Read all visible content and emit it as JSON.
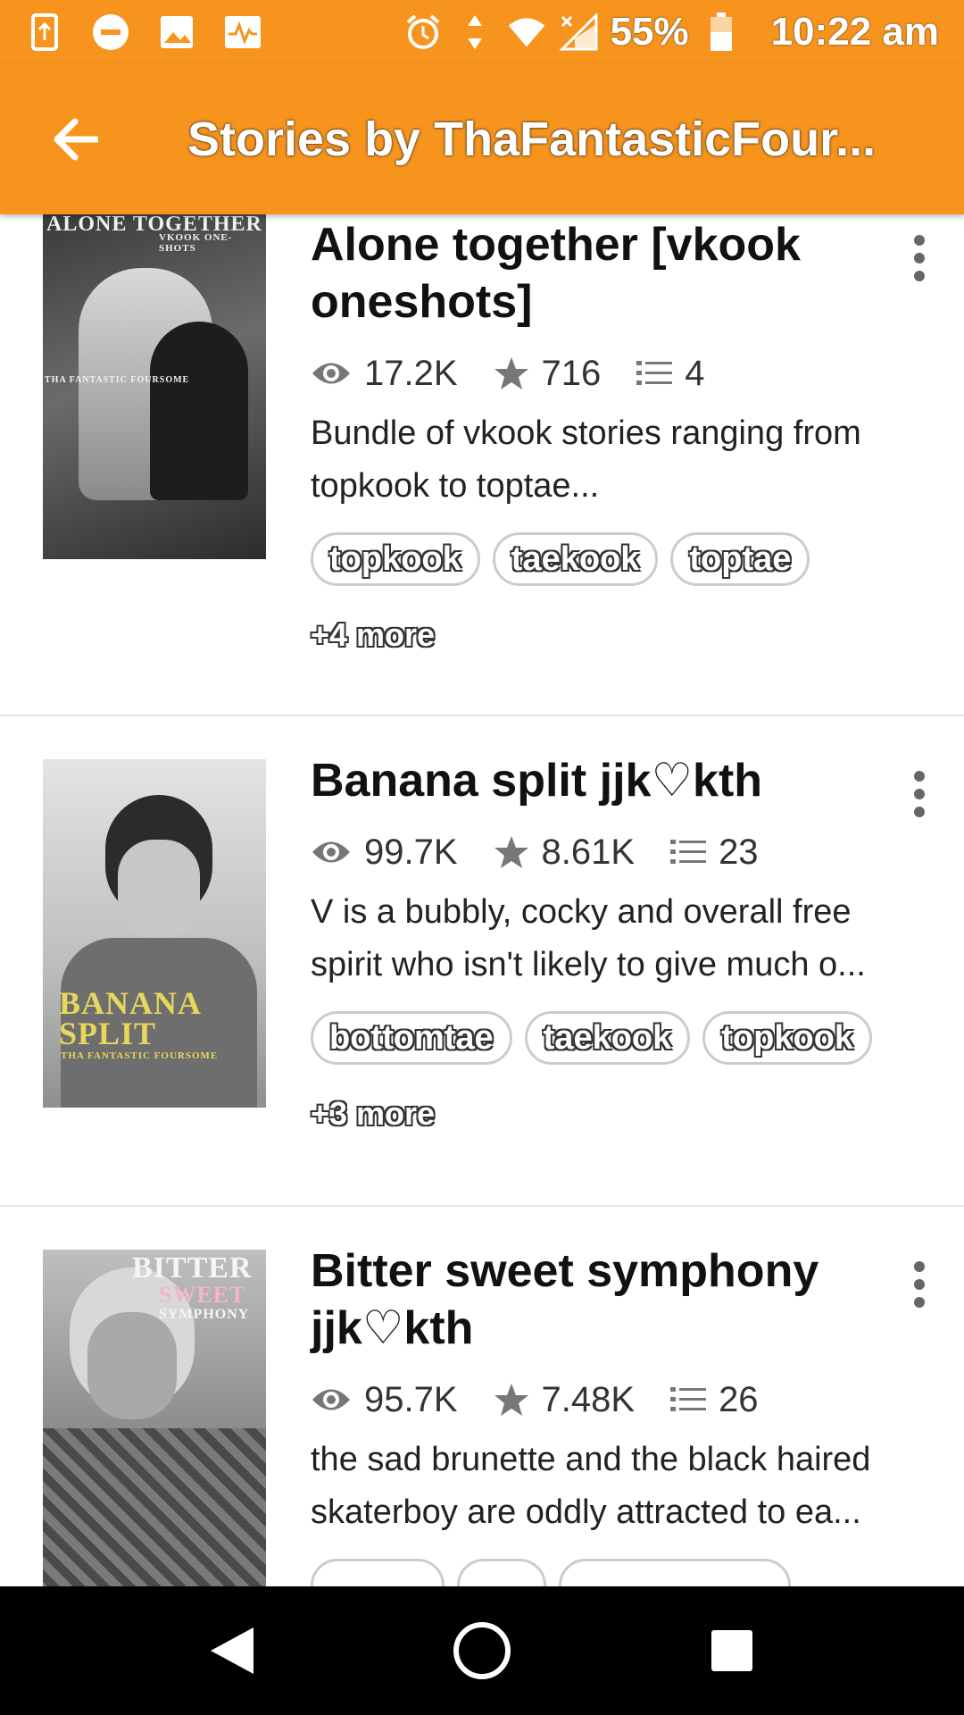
{
  "status_bar": {
    "battery": "55%",
    "time": "10:22 am"
  },
  "appbar": {
    "title": "Stories by ThaFantasticFour..."
  },
  "stories": [
    {
      "title": "Alone together [vkook oneshots]",
      "cover_title": "ALONE TOGETHER",
      "cover_subtitle": "VKOOK ONE-SHOTS",
      "cover_author": "THA FANTASTIC FOURSOME",
      "reads": "17.2K",
      "votes": "716",
      "parts": "4",
      "description": "Bundle of vkook stories ranging from topkook to toptae...",
      "tags": [
        "topkook",
        "taekook",
        "toptae"
      ],
      "more": "+4 more"
    },
    {
      "title": "Banana split jjk♡kth",
      "cover_title": "BANANA SPLIT",
      "cover_author": "THA FANTASTIC FOURSOME",
      "reads": "99.7K",
      "votes": "8.61K",
      "parts": "23",
      "description": "V is a bubbly, cocky and overall free spirit who isn't likely to give much o...",
      "tags": [
        "bottomtae",
        "taekook",
        "topkook"
      ],
      "more": "+3 more"
    },
    {
      "title": "Bitter sweet symphony jjk♡kth",
      "cover_title": "BITTER",
      "cover_subtitle": "SWEET",
      "cover_subtitle2": "SYMPHONY",
      "reads": "95.7K",
      "votes": "7.48K",
      "parts": "26",
      "description": "the sad brunette and the black haired skaterboy are oddly attracted to ea..."
    }
  ],
  "colors": {
    "accent": "#f7941d",
    "nav_bg": "#000000"
  }
}
